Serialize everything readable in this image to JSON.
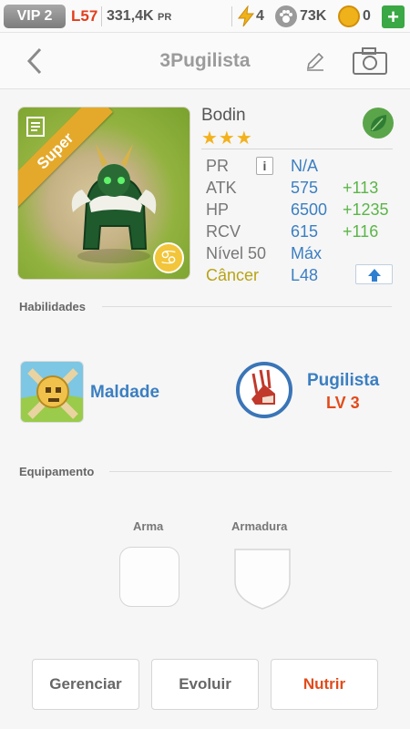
{
  "statusbar": {
    "vip": "VIP 2",
    "level": "L57",
    "power_value": "331,4K",
    "power_unit": "PR",
    "energy": "4",
    "paws": "73K",
    "coins": "0",
    "add": "+",
    "icons": [
      "lightning-icon",
      "paw-icon",
      "coin-icon",
      "plus-icon"
    ]
  },
  "header": {
    "title": "3Pugilista",
    "icons": [
      "back-icon",
      "edit-icon",
      "camera-icon"
    ]
  },
  "pet": {
    "name": "Bodin",
    "stars": "★★★",
    "rank_ribbon": "Super",
    "zodiac_symbol": "♋",
    "element_icon": "leaf-icon",
    "stats": [
      {
        "label": "PR",
        "value": "N/A",
        "bonus": ""
      },
      {
        "label": "ATK",
        "value": "575",
        "bonus": "+113"
      },
      {
        "label": "HP",
        "value": "6500",
        "bonus": "+1235"
      },
      {
        "label": "RCV",
        "value": "615",
        "bonus": "+116"
      },
      {
        "label": "Nível 50",
        "value": "Máx",
        "bonus": ""
      },
      {
        "label": "Câncer",
        "value": "L48",
        "bonus": ""
      }
    ],
    "info_button": "i"
  },
  "abilities": {
    "heading": "Habilidades",
    "skill1": {
      "name": "Maldade"
    },
    "skill2": {
      "name": "Pugilista",
      "level": "LV 3"
    }
  },
  "equipment": {
    "heading": "Equipamento",
    "slots": [
      {
        "label": "Arma"
      },
      {
        "label": "Armadura"
      }
    ]
  },
  "buttons": {
    "manage": "Gerenciar",
    "evolve": "Evoluir",
    "feed": "Nutrir"
  },
  "colors": {
    "accent_blue": "#3b7fc2",
    "bonus_green": "#5bb548",
    "action_red": "#e24b1a",
    "zodiac_yellow": "#b8a315",
    "star_gold": "#f3b21c"
  }
}
